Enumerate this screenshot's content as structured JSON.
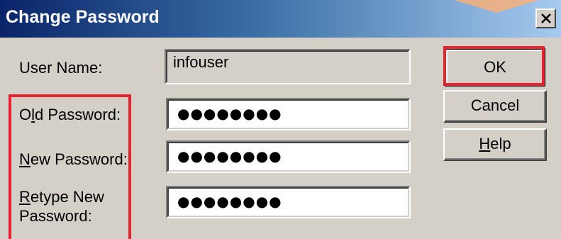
{
  "window": {
    "title": "Change Password",
    "close_icon": "close-icon"
  },
  "form": {
    "user_name": {
      "label": "User Name:",
      "value": "infouser"
    },
    "old_password": {
      "label_pre": "O",
      "label_mnemonic": "l",
      "label_post": "d Password:",
      "value": "●●●●●●●●"
    },
    "new_password": {
      "label_pre": "",
      "label_mnemonic": "N",
      "label_post": "ew Password:",
      "value": "●●●●●●●●"
    },
    "retype_password": {
      "label_line1_pre": "",
      "label_line1_mnemonic": "R",
      "label_line1_post": "etype New",
      "label_line2": "Password:",
      "value": "●●●●●●●●"
    }
  },
  "buttons": {
    "ok": "OK",
    "cancel": "Cancel",
    "help_pre": "",
    "help_mnemonic": "H",
    "help_post": "elp"
  },
  "colors": {
    "title_bar_start": "#0a246a",
    "title_bar_end": "#a6caf0",
    "dialog_face": "#d4d0c8",
    "highlight_red": "#e8212e",
    "accent_orange": "#f6b07a"
  }
}
